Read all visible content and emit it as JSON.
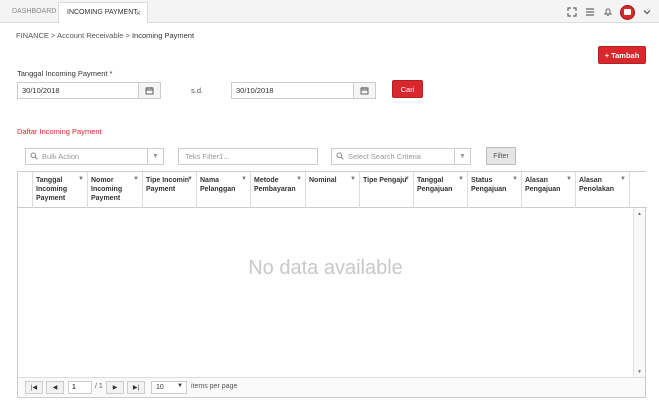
{
  "tabs": [
    {
      "label": "DASHBOARD"
    },
    {
      "label": "INCOMING PAYMENT",
      "close": "×"
    }
  ],
  "topbar": {
    "icons": [
      "expand-icon",
      "menu-icon",
      "bell-icon",
      "avatar",
      "chevron-down-icon"
    ],
    "accent": "#d9272e"
  },
  "breadcrumb": {
    "part1": "FINANCE",
    "sep": ">",
    "part2": "Account Receivable",
    "part3": "Incoming Payment"
  },
  "actions": {
    "tambah_label": "Tambah",
    "tambah_icon": "+"
  },
  "date_filter": {
    "label": "Tanggal Incoming Payment *",
    "from": "30/10/2018",
    "separator": "s.d.",
    "to": "30/10/2018",
    "search_label": "Cari"
  },
  "section": {
    "title": "Daftar Incoming Payment"
  },
  "filters": {
    "bulk_action": "Bulk Action",
    "text_filter_placeholder": "Teks Filter1...",
    "criteria": "Select Search Criteria",
    "filter_button": "Filter"
  },
  "grid": {
    "columns": [
      {
        "l1": "Tanggal",
        "l2": "Incoming",
        "l3": "Payment"
      },
      {
        "l1": "Nomor",
        "l2": "Incoming",
        "l3": "Payment"
      },
      {
        "l1": "Tipe Incomin",
        "l2": "Payment",
        "l3": ""
      },
      {
        "l1": "Nama",
        "l2": "Pelanggan",
        "l3": ""
      },
      {
        "l1": "Metode",
        "l2": "Pembayaran",
        "l3": ""
      },
      {
        "l1": "Nominal",
        "l2": "",
        "l3": ""
      },
      {
        "l1": "Tipe Pengaju",
        "l2": "",
        "l3": ""
      },
      {
        "l1": "Tanggal",
        "l2": "Pengajuan",
        "l3": ""
      },
      {
        "l1": "Status",
        "l2": "Pengajuan",
        "l3": ""
      },
      {
        "l1": "Alasan",
        "l2": "Pengajuan",
        "l3": ""
      },
      {
        "l1": "Alasan",
        "l2": "Penolakan",
        "l3": ""
      }
    ],
    "empty_text": "No data available"
  },
  "pager": {
    "page": "1",
    "of_text": "/ 1",
    "page_size": "10",
    "items_per_page": "items per page"
  }
}
